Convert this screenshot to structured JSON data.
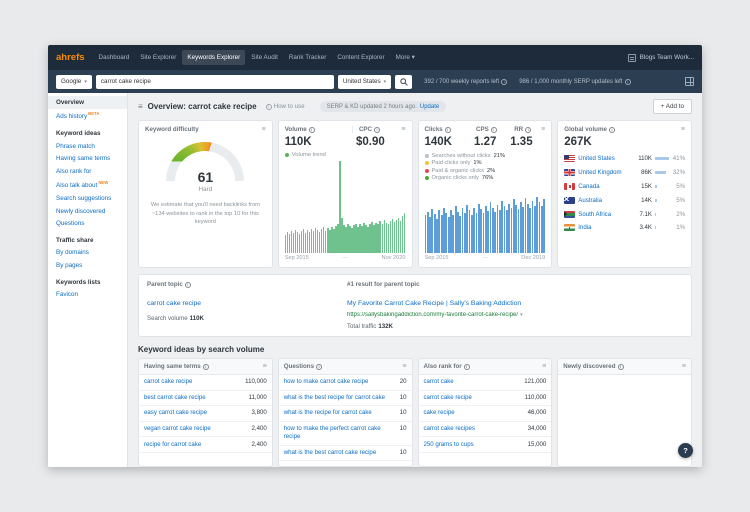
{
  "navbar": {
    "logo": "ahrefs",
    "items": [
      {
        "label": "Dashboard"
      },
      {
        "label": "Site Explorer"
      },
      {
        "label": "Keywords Explorer",
        "active": true
      },
      {
        "label": "Site Audit"
      },
      {
        "label": "Rank Tracker"
      },
      {
        "label": "Content Explorer"
      },
      {
        "label": "More ▾"
      }
    ],
    "workspace": "Blogs Team Work..."
  },
  "searchbar": {
    "engine": "Google",
    "query": "carrot cake recipe",
    "country": "United States",
    "reports_left": "392 / 700 weekly reports left",
    "serp_updates_left": "986 / 1,000 monthly SERP updates left"
  },
  "sidebar": {
    "entries": [
      {
        "type": "item",
        "label": "Overview",
        "active": true
      },
      {
        "type": "item",
        "label": "Ads history",
        "badge": "BETA"
      },
      {
        "type": "header",
        "label": "Keyword ideas"
      },
      {
        "type": "item",
        "label": "Phrase match"
      },
      {
        "type": "item",
        "label": "Having same terms"
      },
      {
        "type": "item",
        "label": "Also rank for"
      },
      {
        "type": "item",
        "label": "Also talk about",
        "badge": "NEW"
      },
      {
        "type": "item",
        "label": "Search suggestions"
      },
      {
        "type": "item",
        "label": "Newly discovered"
      },
      {
        "type": "item",
        "label": "Questions"
      },
      {
        "type": "header",
        "label": "Traffic share"
      },
      {
        "type": "item",
        "label": "By domains"
      },
      {
        "type": "item",
        "label": "By pages"
      },
      {
        "type": "header",
        "label": "Keywords lists"
      },
      {
        "type": "item",
        "label": "Favicon"
      }
    ]
  },
  "header": {
    "title": "Overview: carrot cake recipe",
    "how_to_use": "How to use",
    "update_notice": "SERP & KD updated 2 hours ago.",
    "update_link": "Update",
    "add_to_label": "+ Add to"
  },
  "difficulty": {
    "title": "Keyword difficulty",
    "score": "61",
    "level": "Hard",
    "description": "We estimate that you'll need backlinks from ~134 websites to rank in the top 10 for this keyword"
  },
  "volume": {
    "label": "Volume",
    "value": "110K",
    "cpc_label": "CPC",
    "cpc_value": "$0.90",
    "legend": "Volume trend",
    "range_start": "Sep 2015",
    "range_end": "Nov 2020"
  },
  "clicks": {
    "label": "Clicks",
    "value": "140K",
    "cps_label": "CPS",
    "cps_value": "1.27",
    "rr_label": "RR",
    "rr_value": "1.35",
    "legend": [
      {
        "label": "Searches without clicks",
        "value": "21%",
        "color": "#b9c1c8"
      },
      {
        "label": "Paid clicks only",
        "value": "1%",
        "color": "#f3c13b"
      },
      {
        "label": "Paid & organic clicks",
        "value": "2%",
        "color": "#e2494e"
      },
      {
        "label": "Organic clicks only",
        "value": "76%",
        "color": "#52a336"
      }
    ],
    "range_start": "Sep 2015",
    "range_end": "Dec 2019"
  },
  "global": {
    "title": "Global volume",
    "total": "267K",
    "countries": [
      {
        "name": "United States",
        "flag": "us",
        "volume": "110K",
        "percent": "41%",
        "bar": 14
      },
      {
        "name": "United Kingdom",
        "flag": "gb",
        "volume": "86K",
        "percent": "32%",
        "bar": 11
      },
      {
        "name": "Canada",
        "flag": "ca",
        "volume": "15K",
        "percent": "5%",
        "bar": 2
      },
      {
        "name": "Australia",
        "flag": "au",
        "volume": "14K",
        "percent": "5%",
        "bar": 2
      },
      {
        "name": "South Africa",
        "flag": "za",
        "volume": "7.1K",
        "percent": "2%",
        "bar": 1
      },
      {
        "name": "India",
        "flag": "in",
        "volume": "3.4K",
        "percent": "1%",
        "bar": 1
      }
    ]
  },
  "parent": {
    "title": "Parent topic",
    "keyword": "carrot cake recipe",
    "search_volume_label": "Search volume",
    "search_volume": "110K",
    "result_header": "#1 result for parent topic",
    "result_title": "My Favorite Carrot Cake Recipe | Sally's Baking Addiction",
    "result_url": "https://sallysbakingaddiction.com/my-favorite-carrot-cake-recipe/",
    "total_traffic_label": "Total traffic",
    "total_traffic": "132K"
  },
  "ideas": {
    "title": "Keyword ideas by search volume",
    "columns": [
      {
        "title": "Having same terms",
        "rows": [
          {
            "k": "carrot cake recipe",
            "v": "110,000"
          },
          {
            "k": "best carrot cake recipe",
            "v": "11,000"
          },
          {
            "k": "easy carrot cake recipe",
            "v": "3,800"
          },
          {
            "k": "vegan carrot cake recipe",
            "v": "2,400"
          },
          {
            "k": "recipe for carrot cake",
            "v": "2,400"
          }
        ]
      },
      {
        "title": "Questions",
        "rows": [
          {
            "k": "how to make carrot cake recipe",
            "v": "20"
          },
          {
            "k": "what is the best recipe for carrot cake",
            "v": "10"
          },
          {
            "k": "what is the recipe for carrot cake",
            "v": "10"
          },
          {
            "k": "how to make the perfect carrot cake recipe",
            "v": "10"
          },
          {
            "k": "what is the best carrot cake recipe",
            "v": "10"
          }
        ]
      },
      {
        "title": "Also rank for",
        "rows": [
          {
            "k": "carrot cake",
            "v": "121,000"
          },
          {
            "k": "carrot cake recipe",
            "v": "110,000"
          },
          {
            "k": "cake recipe",
            "v": "46,000"
          },
          {
            "k": "carrot cake recipes",
            "v": "34,000"
          },
          {
            "k": "250 grams to cups",
            "v": "15,000"
          }
        ]
      },
      {
        "title": "Newly discovered",
        "rows": []
      }
    ]
  },
  "help": {
    "label": "?"
  },
  "colors": {
    "accent_orange": "#fb8a02",
    "link_blue": "#0d6cc4",
    "url_green": "#1b7d3a",
    "navbar_bg": "#1e2b3b",
    "searchbar_bg": "#2c3e52",
    "volume_bar": "#6fc18e",
    "clicks_bar": "#5e9ed8"
  },
  "chart_data": [
    {
      "type": "bar",
      "title": "Volume trend",
      "x_range": [
        "Sep 2015",
        "Nov 2020"
      ],
      "values": [
        20,
        23,
        21,
        24,
        22,
        25,
        23,
        21,
        24,
        26,
        22,
        25,
        23,
        26,
        24,
        27,
        25,
        23,
        26,
        28,
        24,
        27,
        25,
        28,
        26,
        29,
        32,
        100,
        38,
        30,
        28,
        31,
        29,
        27,
        30,
        32,
        28,
        31,
        29,
        33,
        30,
        28,
        32,
        34,
        30,
        33,
        31,
        35,
        32,
        36,
        33,
        31,
        35,
        37,
        34,
        36,
        38,
        35,
        40,
        43
      ]
    },
    {
      "type": "bar",
      "title": "Clicks trend",
      "x_range": [
        "Sep 2015",
        "Dec 2019"
      ],
      "values": [
        55,
        60,
        52,
        64,
        57,
        50,
        62,
        55,
        66,
        58,
        52,
        63,
        56,
        68,
        60,
        54,
        65,
        58,
        70,
        62,
        56,
        66,
        59,
        72,
        64,
        58,
        68,
        61,
        74,
        66,
        60,
        70,
        63,
        76,
        68,
        62,
        72,
        65,
        78,
        70,
        64,
        74,
        67,
        80,
        72,
        66,
        76,
        69,
        82,
        74,
        68,
        78
      ]
    }
  ]
}
